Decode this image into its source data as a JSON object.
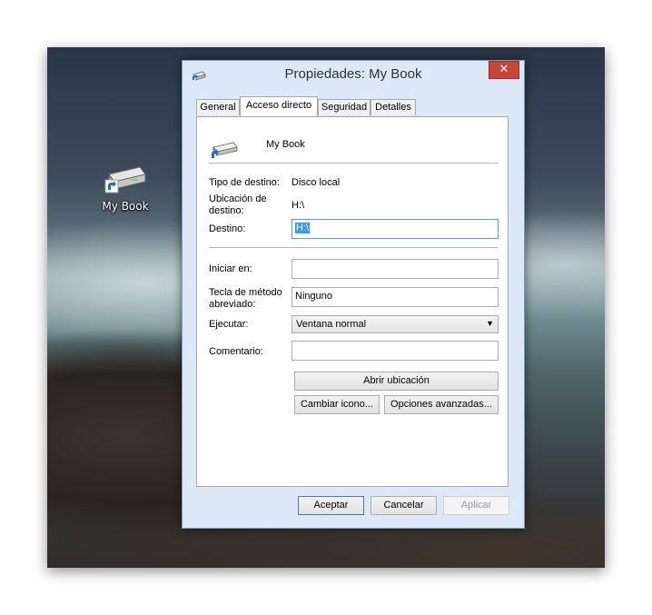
{
  "desktop": {
    "icon_label": "My Book"
  },
  "window": {
    "title": "Propiedades: My Book",
    "close_glyph": "✕",
    "tabs": [
      {
        "label": "General",
        "active": false
      },
      {
        "label": "Acceso directo",
        "active": true
      },
      {
        "label": "Seguridad",
        "active": false
      },
      {
        "label": "Detalles",
        "active": false
      }
    ]
  },
  "shortcut": {
    "name": "My Book",
    "target_type_label": "Tipo de destino:",
    "target_type_value": "Disco local",
    "target_location_label": "Ubicación de destino:",
    "target_location_value": "H:\\",
    "target_label": "Destino:",
    "target_value": "H:\\",
    "start_in_label": "Iniciar en:",
    "start_in_value": "",
    "shortcut_key_label": "Tecla de método abreviado:",
    "shortcut_key_value": "Ninguno",
    "run_label": "Ejecutar:",
    "run_value": "Ventana normal",
    "comment_label": "Comentario:",
    "comment_value": ""
  },
  "actions": {
    "open_location": "Abrir ubicación",
    "change_icon": "Cambiar icono...",
    "advanced": "Opciones avanzadas..."
  },
  "footer": {
    "ok": "Aceptar",
    "cancel": "Cancelar",
    "apply": "Aplicar"
  }
}
